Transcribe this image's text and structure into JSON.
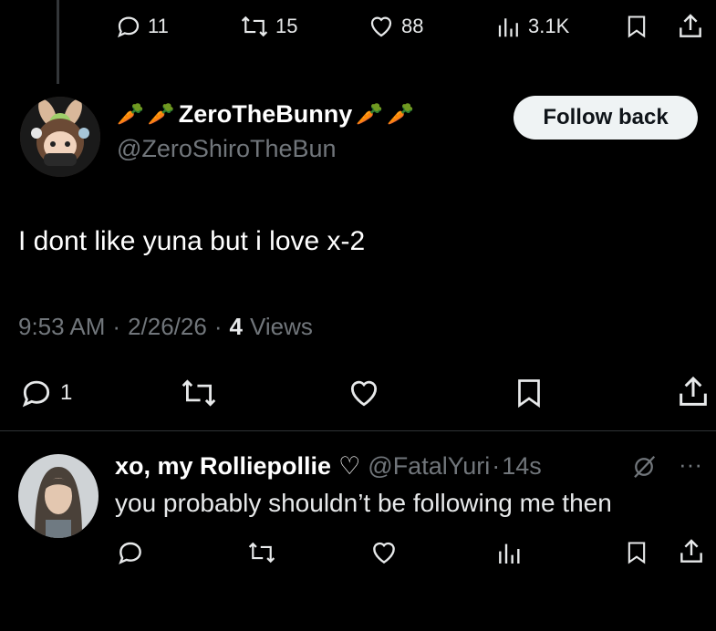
{
  "top_actions": {
    "replies": "11",
    "reposts": "15",
    "likes": "88",
    "views": "3.1K"
  },
  "tweet": {
    "display_name": "ZeroTheBunny",
    "carrot_emoji": "🥕",
    "handle": "@ZeroShiroTheBun",
    "follow_label": "Follow back",
    "text": "I dont like yuna but i love x-2",
    "time": "9:53 AM",
    "sep1": "·",
    "date": "2/26/26",
    "sep2": "·",
    "views_count": "4",
    "views_label": "Views",
    "reply_count": "1"
  },
  "reply": {
    "display_name": "xo, my Rolliepollie",
    "heart_emoji": "♡",
    "handle": "@FatalYuri",
    "sep": "·",
    "age": "14s",
    "more": "···",
    "text": "you probably shouldn’t be following me then"
  },
  "colors": {
    "background": "#000000",
    "text": "#e7e9ea",
    "muted": "#71767b",
    "button_bg": "#eff3f4"
  }
}
